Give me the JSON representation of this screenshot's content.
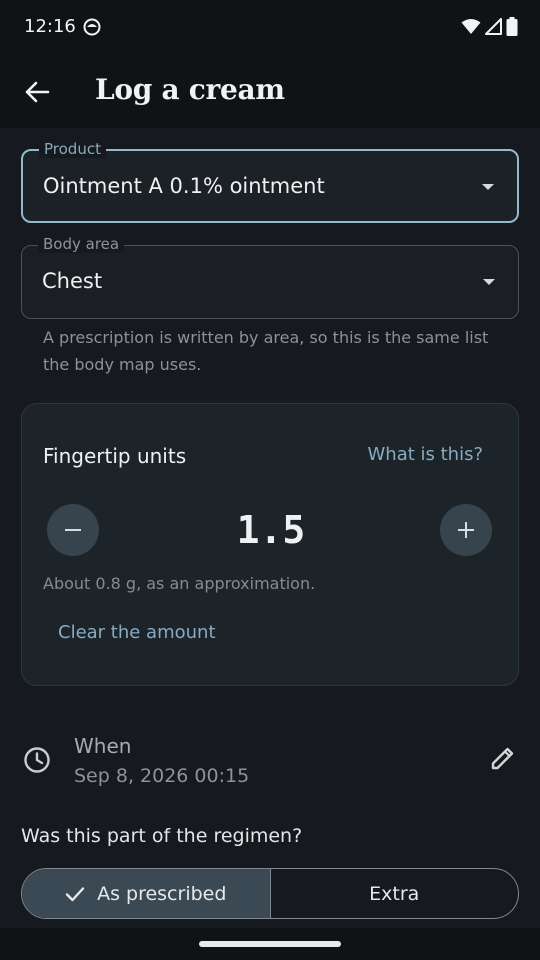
{
  "status_bar": {
    "time": "12:16",
    "icons": [
      "app-notification-icon",
      "wifi-icon",
      "cell-signal-icon",
      "battery-icon"
    ]
  },
  "app_bar": {
    "title": "Log a cream",
    "back_icon": "arrow-back-icon"
  },
  "form": {
    "product": {
      "label": "Product",
      "value": "Ointment A  0.1% ointment"
    },
    "body_area": {
      "label": "Body area",
      "value": "Chest"
    },
    "helper": "A prescription is written by area, so this is the same list the body map uses."
  },
  "fingertip_card": {
    "title": "Fingertip units",
    "help_link": "What is this?",
    "value": "1.5",
    "note": "About 0.8 g, as an approximation.",
    "clear_label": "Clear the amount"
  },
  "when": {
    "label": "When",
    "value": "Sep 8, 2026 00:15"
  },
  "regimen": {
    "question": "Was this part of the regimen?",
    "options": [
      {
        "label": "As prescribed",
        "selected": true
      },
      {
        "label": "Extra",
        "selected": false
      }
    ]
  },
  "colors": {
    "background": "#16191d",
    "accent": "#88abc1",
    "focus_border": "#94b8cf",
    "selected_segment": "#3a4953"
  }
}
